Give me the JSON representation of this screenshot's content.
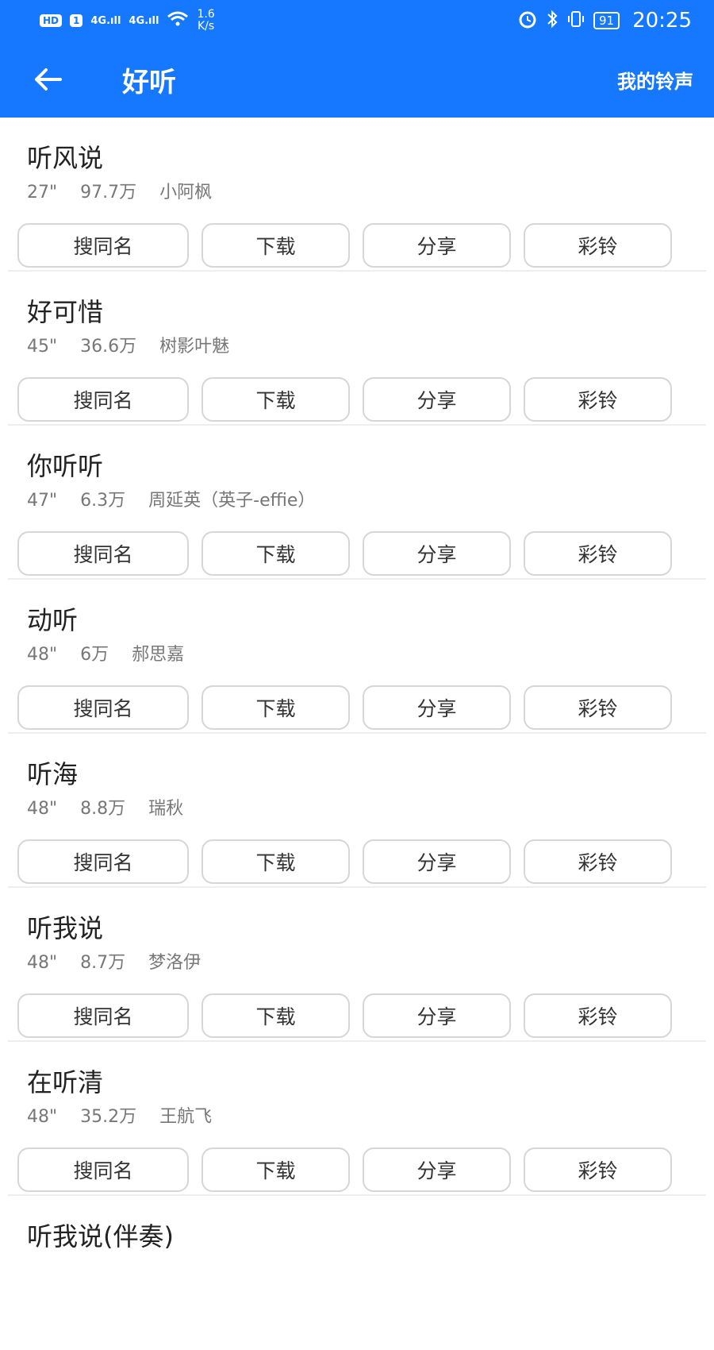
{
  "status_bar": {
    "hd": "HD",
    "sim": "1",
    "net1": "4G.ıll",
    "net2": "4G.ıll",
    "speed_value": "1.6",
    "speed_unit": "K/s",
    "battery": "91",
    "time": "20:25"
  },
  "header": {
    "title": "好听",
    "right_link": "我的铃声"
  },
  "buttons": {
    "search_same": "搜同名",
    "download": "下载",
    "share": "分享",
    "ringback": "彩铃"
  },
  "songs": [
    {
      "title": "听风说",
      "duration": "27\"",
      "plays": "97.7万",
      "artist": "小阿枫"
    },
    {
      "title": "好可惜",
      "duration": "45\"",
      "plays": "36.6万",
      "artist": "树影叶魅"
    },
    {
      "title": "你听听",
      "duration": "47\"",
      "plays": "6.3万",
      "artist": "周延英（英子-effie）"
    },
    {
      "title": "动听",
      "duration": "48\"",
      "plays": "6万",
      "artist": "郝思嘉"
    },
    {
      "title": "听海",
      "duration": "48\"",
      "plays": "8.8万",
      "artist": "瑞秋"
    },
    {
      "title": "听我说",
      "duration": "48\"",
      "plays": "8.7万",
      "artist": "梦洛伊"
    },
    {
      "title": "在听清",
      "duration": "48\"",
      "plays": "35.2万",
      "artist": "王航飞"
    },
    {
      "title": "听我说(伴奏)",
      "duration": "",
      "plays": "",
      "artist": ""
    }
  ]
}
